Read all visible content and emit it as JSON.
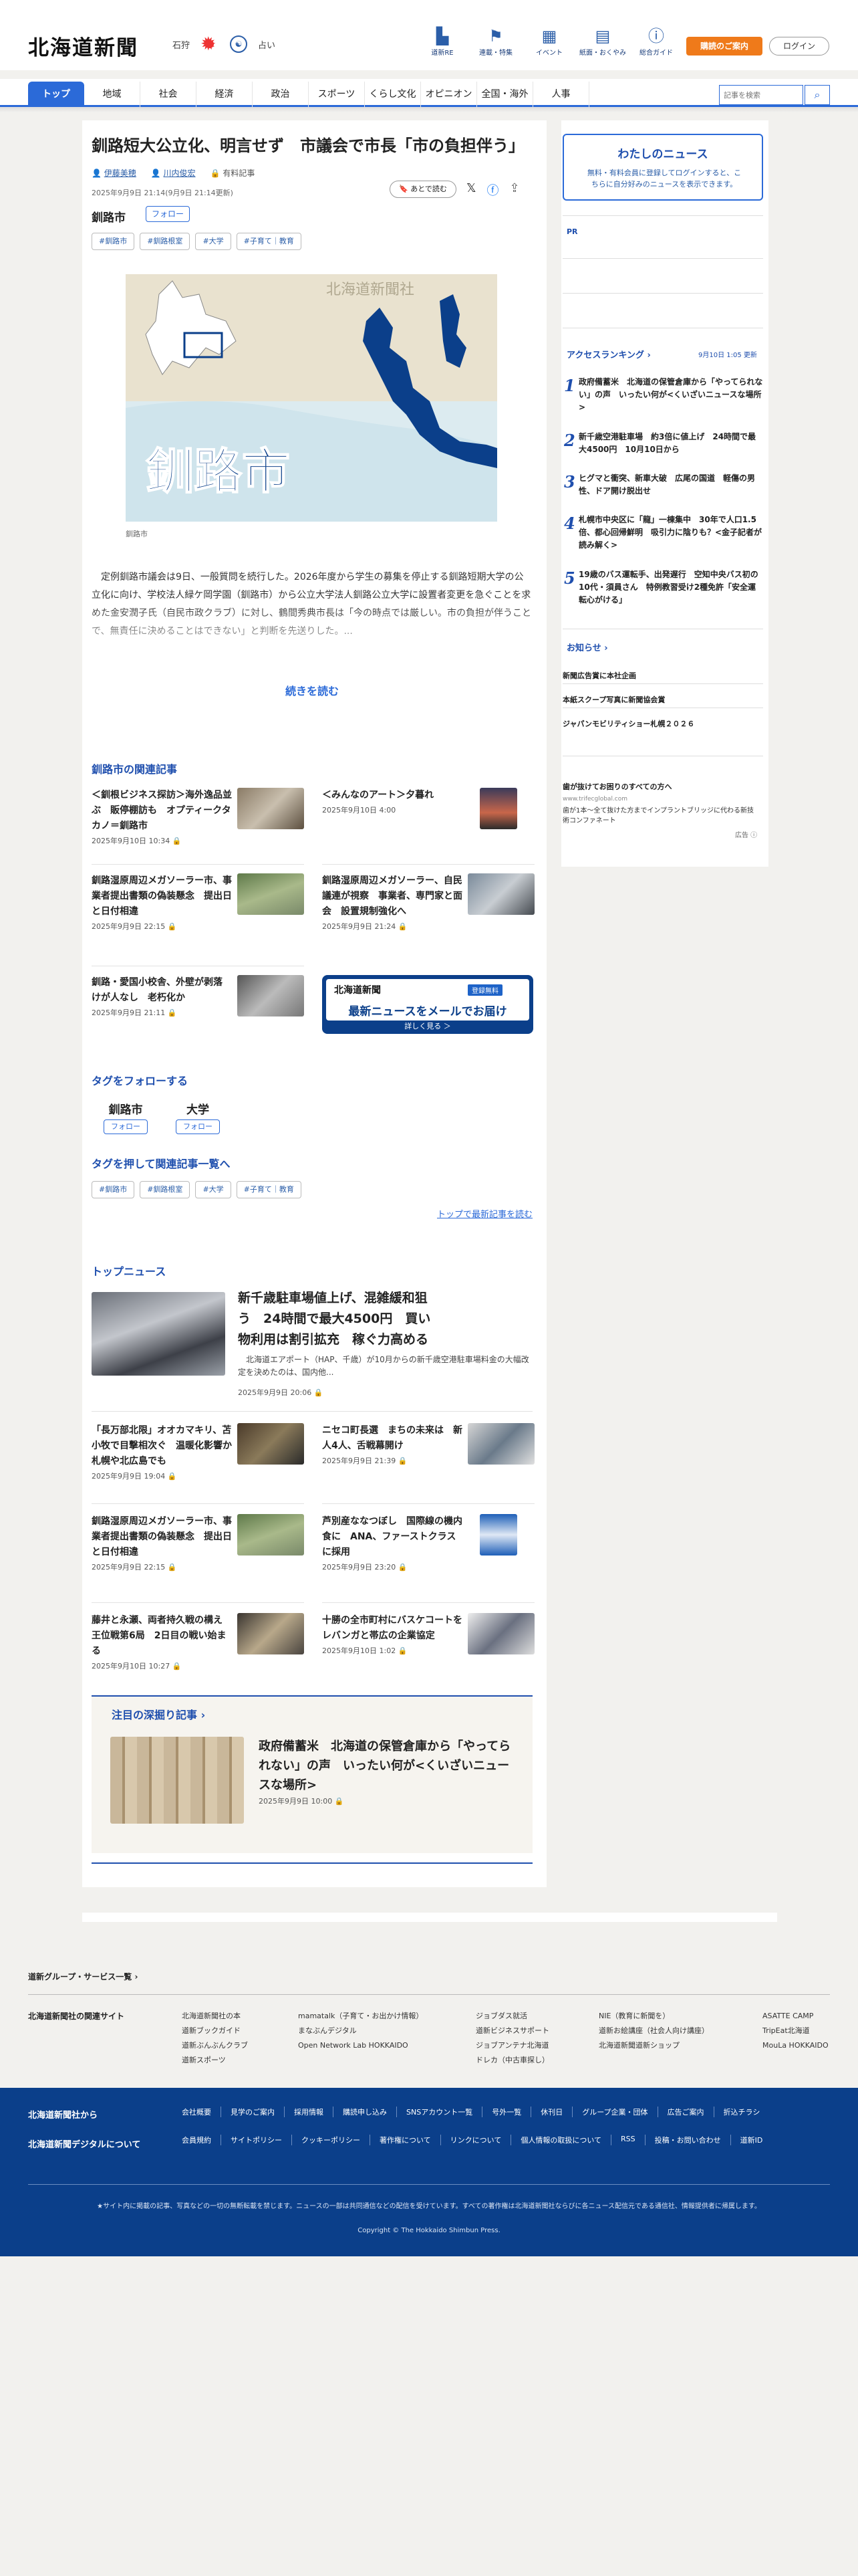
{
  "header": {
    "logo": "北海道新聞",
    "city": "石狩",
    "fortune": "占い",
    "icon_nav": [
      {
        "label": "道新RE",
        "icon": "book-icon"
      },
      {
        "label": "連載・特集",
        "icon": "flag-icon"
      },
      {
        "label": "イベント",
        "icon": "calendar-icon"
      },
      {
        "label": "紙面・おくやみ",
        "icon": "newspaper-icon"
      },
      {
        "label": "総合ガイド",
        "icon": "question-icon"
      }
    ],
    "subscribe": "購読のご案内",
    "login": "ログイン"
  },
  "nav": {
    "tabs": [
      "トップ",
      "地域",
      "社会",
      "経済",
      "政治",
      "スポーツ",
      "くらし文化",
      "オピニオン",
      "全国・海外",
      "人事"
    ],
    "search_placeholder": "記事を検索"
  },
  "article": {
    "title": "釧路短大公立化、明言せず　市議会で市長「市の負担伴う」",
    "author": "伊藤美穂",
    "author2": "川内俊宏",
    "members": "有料記事",
    "dates": "2025年9月9日 21:14(9月9日 21:14更新)",
    "read_later": "あとで読む",
    "topic": "釧路市",
    "follow": "フォロー",
    "tags": [
      "#釧路市",
      "#釧路根室",
      "#大学",
      "#子育て｜教育"
    ],
    "map_watermark": "北海道新聞社",
    "map_text": "釧路市",
    "caption": "釧路市",
    "body": "定例釧路市議会は9日、一般質問を続行した。2026年度から学生の募集を停止する釧路短期大学の公立化に向け、学校法人緑ケ岡学園（釧路市）から公立大学法人釧路公立大学に設置者変更を急ぐことを求めた金安潤子氏（自民市政クラブ）に対し、鶴間秀典市長は「今の時点では厳しい。市の負担が伴うことで、無責任に決めることはできない」と判断を先送りした。...",
    "read_more": "続きを読む"
  },
  "related": {
    "title": "釧路市の関連記事",
    "items": [
      {
        "title": "＜釧根ビジネス探訪＞海外逸品並ぶ　販停棚訪も　オプティークタカノ＝釧路市",
        "date": "2025年9月10日 10:34"
      },
      {
        "title": "＜みんなのアート＞夕暮れ",
        "date": "2025年9月10日 4:00"
      },
      {
        "title": "釧路湿原周辺メガソーラー市、事業者提出書類の偽装懸念　提出日と日付相違",
        "date": "2025年9月9日 22:15"
      },
      {
        "title": "釧路湿原周辺メガソーラー、自民議連が視察　事業者、専門家と面会　設置規制強化へ",
        "date": "2025年9月9日 21:24"
      },
      {
        "title": "釧路・愛国小校舎、外壁が剥落　けが人なし　老朽化か",
        "date": "2025年9月9日 21:11"
      }
    ],
    "mail_logo": "北海道新聞",
    "mail_badge": "登録無料",
    "mail_text": "最新ニュースをメールでお届け",
    "mail_more": "詳しく見る ＞"
  },
  "follow_tags": {
    "title": "タグをフォローする",
    "items": [
      "釧路市",
      "大学"
    ],
    "button": "フォロー"
  },
  "tag_search": {
    "title": "タグを押して関連記事一覧へ",
    "tags": [
      "#釧路市",
      "#釧路根室",
      "#大学",
      "#子育て｜教育"
    ],
    "latest_link": "トップで最新記事を読む"
  },
  "top_news": {
    "title": "トップニュース",
    "lead": {
      "title": "新千歳駐車場値上げ、混雑緩和狙う　24時間で最大4500円　買い物利用は割引拡充　稼ぐ力高める",
      "summary": "北海道エアポート（HAP、千歳）が10月からの新千歳空港駐車場料金の大幅改定を決めたのは、国内他...",
      "date": "2025年9月9日 20:06"
    },
    "items": [
      {
        "title": "「長万部北限」オオカマキリ、苫小牧で目撃相次ぐ　温暖化影響か　札幌や北広島でも",
        "date": "2025年9月9日 19:04"
      },
      {
        "title": "ニセコ町長選　まちの未来は　新人4人、舌戦幕開け",
        "date": "2025年9月9日 21:39"
      },
      {
        "title": "釧路湿原周辺メガソーラー市、事業者提出書類の偽装懸念　提出日と日付相違",
        "date": "2025年9月9日 22:15"
      },
      {
        "title": "芦別産ななつぼし　国際線の機内食に　ANA、ファーストクラスに採用",
        "date": "2025年9月9日 23:20"
      },
      {
        "title": "藤井と永瀬、両者持久戦の構え　王位戦第6局　2日目の戦い始まる",
        "date": "2025年9月10日 10:27"
      },
      {
        "title": "十勝の全市町村にバスケコートを　レバンガと帯広の企業協定",
        "date": "2025年9月10日 1:02"
      }
    ]
  },
  "deep_dive": {
    "title": "注目の深掘り記事",
    "head": "政府備蓄米　北海道の保管倉庫から「やってられない」の声　いったい何が<くいざいニュースな場所>",
    "date": "2025年9月9日 10:00"
  },
  "sidebar": {
    "mynews_title": "わたしのニュース",
    "mynews_text": "無料・有料会員に登録してログインすると、こちらに自分好みのニュースを表示できます。",
    "pr": "PR",
    "ranking_title": "アクセスランキング",
    "ranking_date": "9月10日 1:05 更新",
    "ranking": [
      {
        "num": "1",
        "title": "政府備蓄米　北海道の保管倉庫から「やってられない」の声　いったい何が<くいざいニュースな場所>"
      },
      {
        "num": "2",
        "title": "新千歳空港駐車場　約3倍に値上げ　24時間で最大4500円　10月10日から"
      },
      {
        "num": "3",
        "title": "ヒグマと衝突、新車大破　広尾の国道　軽傷の男性、ドア開け脱出せ"
      },
      {
        "num": "4",
        "title": "札幌市中央区に「龍」一棟集中　30年で人口1.5倍、都心回帰鮮明　吸引力に陰りも？<金子記者が読み解く>"
      },
      {
        "num": "5",
        "title": "19歳のバス運転手、出発遅行　空知中央バス初の10代・須員さん　特例教習受け2種免許「安全運転心がける」"
      }
    ],
    "info_title": "お知らせ",
    "info": [
      "新聞広告賞に本社企画",
      "本紙スクープ写真に新聞協会賞",
      "ジャパンモビリティショー札幌２０２６"
    ],
    "ad_title": "歯が抜けてお困りのすべての方へ",
    "ad_domain": "www.trifecglobal.com",
    "ad_text": "歯が1本〜全て抜けた方までインプラントブリッジに代わる新技術コンファネート",
    "ad_tag": "広告 ⓘ"
  },
  "footer": {
    "services": "道新グループ・サービス一覧",
    "related_label": "北海道新聞社の関連サイト",
    "related_cols": [
      [
        "北海道新聞社の本",
        "道新ブックガイド",
        "道新ぶんぶんクラブ",
        "道新スポーツ"
      ],
      [
        "mamatalk（子育て・お出かけ情報）",
        "まなぶんデジタル",
        "Open Network Lab HOKKAIDO"
      ],
      [
        "ジョブダス就活",
        "道新ビジネスサポート",
        "ジョブアンテナ北海道",
        "ドレカ（中古車探し）"
      ],
      [
        "NIE（教育に新聞を）",
        "道新お絵講座（社会人向け講座）",
        "北海道新聞道新ショップ"
      ],
      [
        "ASATTE CAMP",
        "TripEat北海道",
        "MouLa HOKKAIDO"
      ]
    ],
    "from_company": "北海道新聞社から",
    "about_digital": "北海道新聞デジタルについて",
    "company_links": [
      "会社概要",
      "見学のご案内",
      "採用情報",
      "購読申し込み",
      "SNSアカウント一覧",
      "号外一覧",
      "休刊日",
      "グループ企業・団体",
      "広告ご案内",
      "折込チラシ"
    ],
    "digital_links": [
      "会員規約",
      "サイトポリシー",
      "クッキーポリシー",
      "著作権について",
      "リンクについて",
      "個人情報の取扱について",
      "RSS",
      "投稿・お問い合わせ",
      "道新ID"
    ],
    "note": "★サイト内に掲載の記事、写真などの一切の無断転載を禁じます。ニュースの一部は共同通信などの配信を受けています。すべての著作権は北海道新聞社ならびに各ニュース配信元である通信社、情報提供者に帰属します。",
    "copyright": "Copyright © The Hokkaido Shimbun Press."
  },
  "colors": {
    "brand": "#1f4fae",
    "accent_orange": "#ef7a1a",
    "footer": "#0b3f8a"
  }
}
